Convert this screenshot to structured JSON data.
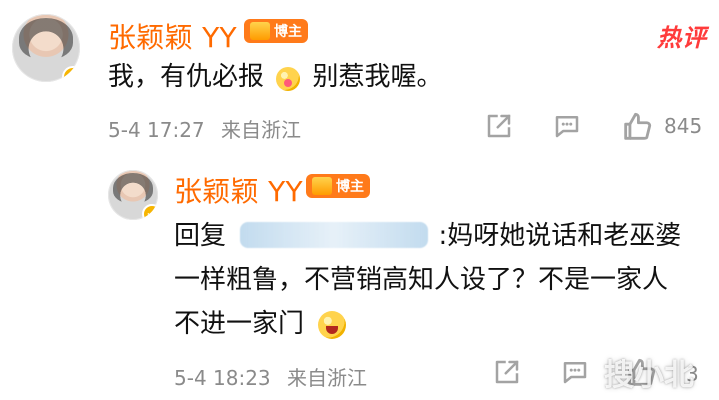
{
  "comment": {
    "author": "张颖颖 YY",
    "badge": "博主",
    "hot_tag": "热评",
    "text_before": "我，有仇必报",
    "text_after": "别惹我喔。",
    "meta_time": "5-4 17:27",
    "meta_source": "来自浙江",
    "like_count": "845"
  },
  "reply": {
    "author": "张颖颖 YY",
    "badge": "博主",
    "prefix": "回复",
    "after_mention": ":妈呀她说话和老巫婆",
    "line2": "一样粗鲁，不营销高知人设了？不是一家人",
    "line3": "不进一家门",
    "meta_time": "5-4 18:23",
    "meta_source": "来自浙江",
    "like_count_partial": "3"
  },
  "watermark": {
    "text": "搜小北"
  },
  "icons": {
    "share": "share-icon",
    "comment": "comment-icon",
    "like": "thumbs-up-icon",
    "verified": "verified-icon"
  },
  "colors": {
    "name": "#ff6a00",
    "badge_bg": "#ff7a1a",
    "hot": "#ff3b3b",
    "meta": "#8a8a8a",
    "icon": "#a3a3a3",
    "verified": "#f7b500"
  }
}
